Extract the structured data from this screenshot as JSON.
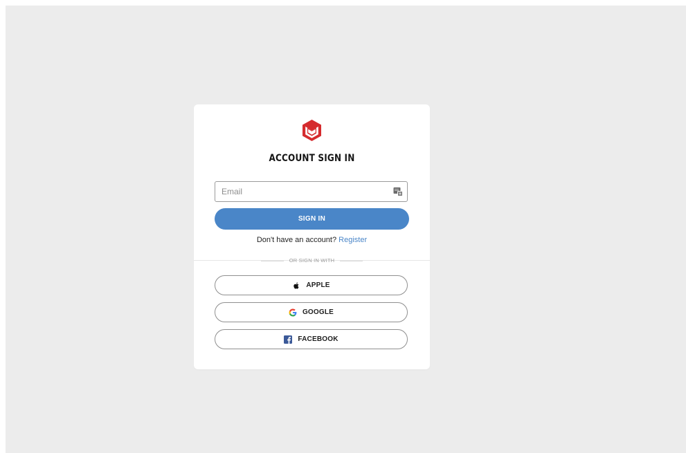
{
  "card": {
    "title": "ACCOUNT SIGN IN",
    "email": {
      "placeholder": "Email",
      "value": ""
    },
    "signin_label": "SIGN IN",
    "register_prompt": "Don't have an account?",
    "register_link": "Register",
    "divider_text": "OR SIGN IN WITH",
    "social": {
      "apple_label": "APPLE",
      "google_label": "GOOGLE",
      "facebook_label": "FACEBOOK"
    }
  },
  "colors": {
    "page_background": "#ececec",
    "card_background": "#ffffff",
    "accent": "#4a86c8",
    "logo_red": "#d52b2e",
    "facebook_blue": "#3b5998"
  },
  "icons": {
    "logo": "brand-logo-icon",
    "email_field_icon": "autofill-icon",
    "apple": "apple-icon",
    "google": "google-icon",
    "facebook": "facebook-icon"
  }
}
